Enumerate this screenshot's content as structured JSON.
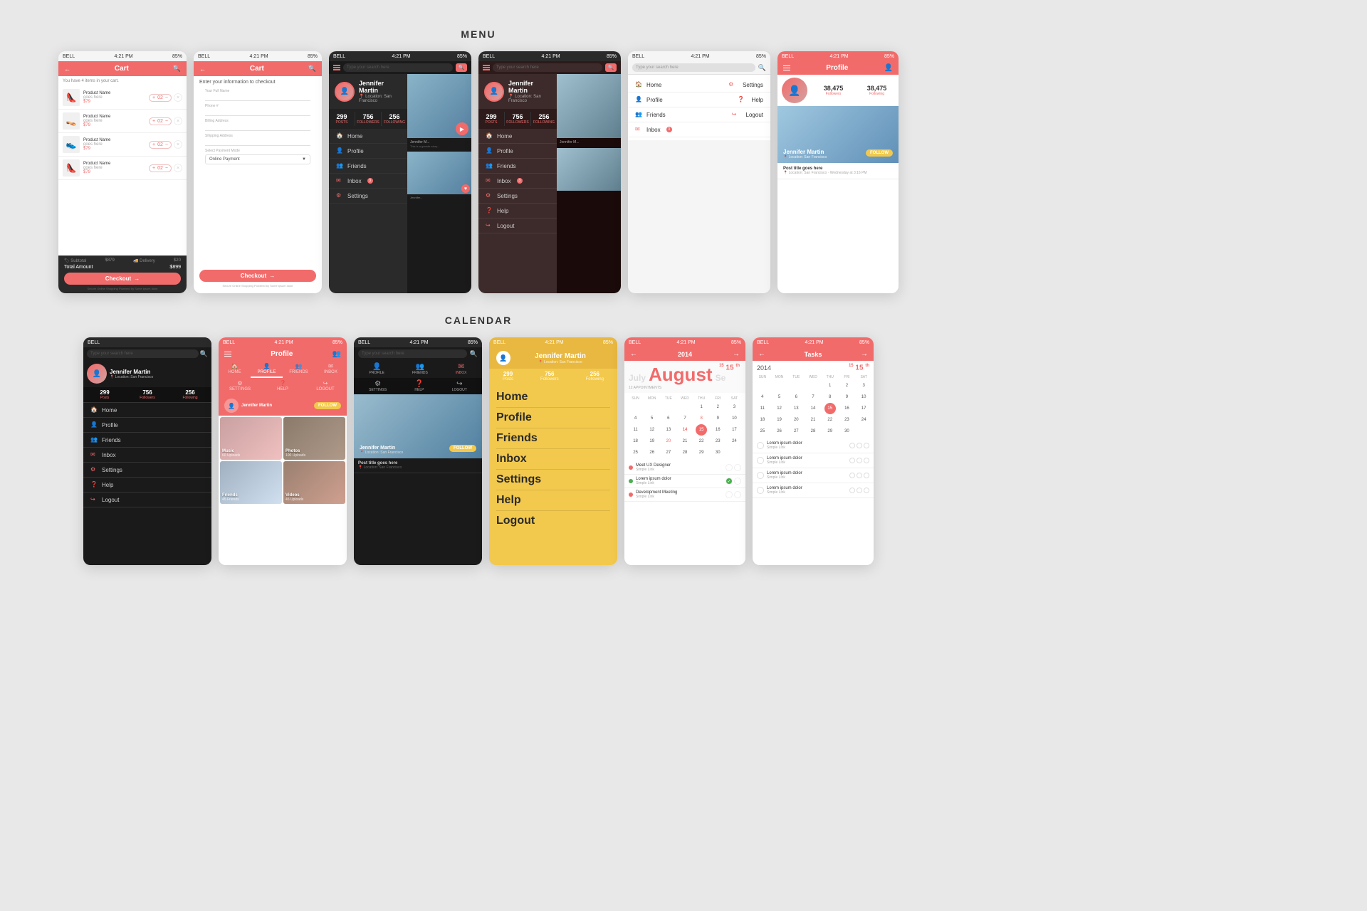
{
  "sections": {
    "menu": "MENU",
    "calendar": "CALENDAR"
  },
  "cart": {
    "title": "Cart",
    "has_items": "You have 4 items in your cart.",
    "items": [
      {
        "name": "Product Name",
        "desc": "goes here",
        "price": "$79",
        "qty": "02",
        "icon": "👠"
      },
      {
        "name": "Product Name",
        "desc": "goes here",
        "price": "$79",
        "qty": "02",
        "icon": "👡"
      },
      {
        "name": "Product Name",
        "desc": "goes here",
        "price": "$79",
        "qty": "02",
        "icon": "👟"
      },
      {
        "name": "Product Name",
        "desc": "goes here",
        "price": "$79",
        "qty": "02",
        "icon": "👠"
      }
    ],
    "subtotal_label": "Subtotal",
    "subtotal": "$879",
    "delivery_label": "Delivery",
    "delivery": "$20",
    "total_label": "Total Amount",
    "total": "$899",
    "checkout": "Checkout"
  },
  "checkout_form": {
    "title": "Cart",
    "instructions": "Enter your information to checkout",
    "full_name_label": "Your Full Name",
    "phone_label": "Phone #",
    "billing_label": "Billing Address",
    "shipping_label": "Shipping Address",
    "payment_label": "Select Payment Mode",
    "payment_default": "Online Payment",
    "checkout": "Checkout"
  },
  "profile": {
    "name": "Jennifer Martin",
    "location": "Location: San Francisco",
    "posts": "299",
    "followers": "756",
    "following": "256",
    "posts_label": "Posts",
    "followers_label": "Followers",
    "following_label": "Following",
    "follow_btn": "FOLLOW",
    "followers_count_profile": "38,475",
    "following_count_profile": "38,475"
  },
  "menu_items": {
    "home": "Home",
    "profile": "Profile",
    "friends": "Friends",
    "inbox": "Inbox",
    "settings": "Settings",
    "help": "Help",
    "logout": "Logout"
  },
  "menu_items_light": {
    "home": "Home",
    "profile": "Profile",
    "friends": "Friends",
    "inbox": "Inbox",
    "settings": "Settings",
    "help": "Help",
    "logout": "Logout"
  },
  "status_bars": {
    "bell": "BELL",
    "time": "4:21 PM",
    "battery": "85%"
  },
  "nav_tabs": {
    "home": "HOME",
    "profile": "PROFILE",
    "friends": "FRIENDS",
    "inbox": "INBOX",
    "settings": "SETTINGS",
    "help": "HELP",
    "logout": "LOGOUT"
  },
  "media": {
    "music": "Music",
    "music_count": "60 Uploads",
    "photos": "Photos",
    "photos_count": "100 Uploads",
    "friends": "Friends",
    "friends_count": "45 Friends",
    "videos": "Videos",
    "videos_count": "45 Uploads"
  },
  "post": {
    "title": "Post title goes here",
    "location": "Location: San Francisco",
    "date": "Wednesday at 3:16 PM"
  },
  "calendar": {
    "year": "2014",
    "month": "August",
    "day": "15",
    "prev_month": "July",
    "next_month": "Se",
    "day_headers": [
      "SUN",
      "MON",
      "TUE",
      "WED",
      "THU",
      "FRI",
      "SAT"
    ],
    "days": [
      "",
      "",
      "",
      "",
      "1",
      "2",
      "3",
      "4",
      "5",
      "6",
      "7",
      "8",
      "9",
      "10",
      "11",
      "12",
      "13",
      "14",
      "15",
      "16",
      "17",
      "18",
      "19",
      "20",
      "21",
      "22",
      "23",
      "24",
      "25",
      "26",
      "27",
      "28",
      "29",
      "30",
      "",
      ""
    ]
  },
  "tasks_title": "Tasks",
  "appointments": [
    {
      "title": "Meet UX Designer",
      "sub": "Simple Link"
    },
    {
      "title": "Lorem ipsum dolor",
      "sub": "Simple Link"
    },
    {
      "title": "Development Meeting",
      "sub": "Simple Link"
    },
    {
      "title": "Meet UX Designer",
      "sub": "Simple Link"
    },
    {
      "title": "Development Meeting",
      "sub": "Simple Link"
    }
  ],
  "tasks": [
    {
      "title": "Lorem ipsum dolor",
      "sub": "Simple Link",
      "done": false
    },
    {
      "title": "Lorem ipsum dolor",
      "sub": "Simple Link",
      "done": false
    },
    {
      "title": "Lorem ipsum dolor",
      "sub": "Simple Link",
      "done": false
    },
    {
      "title": "Lorem ipsum dolor",
      "sub": "Simple Link",
      "done": false
    }
  ],
  "search_placeholder": "Type your search here"
}
